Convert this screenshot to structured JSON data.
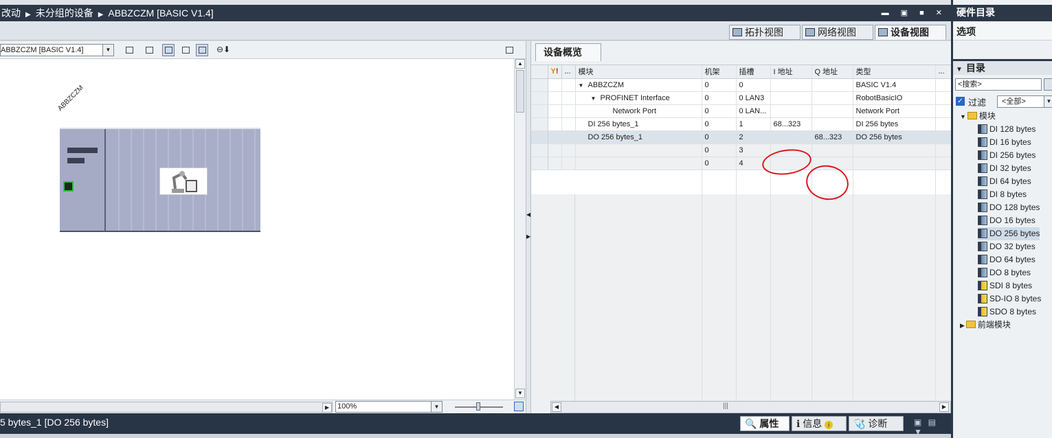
{
  "title_bar": {
    "breadcrumb": [
      "改动",
      "未分组的设备",
      "ABBZCZM [BASIC V1.4]"
    ],
    "window_buttons": "▬ ▣ ■ ✕"
  },
  "view_tabs": [
    "拓扑视图",
    "网络视图",
    "设备视图"
  ],
  "left_toolbar": {
    "device_select": "ABBZCZM [BASIC V1.4]"
  },
  "canvas": {
    "device_label": "ABBZCZM"
  },
  "left_bottom": {
    "zoom": "100%"
  },
  "overview": {
    "tab_label": "设备概览",
    "columns": [
      "...",
      "模块",
      "机架",
      "插槽",
      "I 地址",
      "Q 地址",
      "类型",
      "..."
    ],
    "rows": [
      {
        "indent": 0,
        "expander": "▼",
        "module": "ABBZCZM",
        "rack": "0",
        "slot": "0",
        "i_addr": "",
        "q_addr": "",
        "type": "BASIC V1.4",
        "selected": false
      },
      {
        "indent": 1,
        "expander": "▼",
        "module": "PROFINET Interface",
        "rack": "0",
        "slot": "0 LAN3",
        "i_addr": "",
        "q_addr": "",
        "type": "RobotBasicIO",
        "selected": false
      },
      {
        "indent": 2,
        "expander": "",
        "module": "Network Port",
        "rack": "0",
        "slot": "0 LAN...",
        "i_addr": "",
        "q_addr": "",
        "type": "Network Port",
        "selected": false
      },
      {
        "indent": 0,
        "expander": "",
        "module": "DI 256 bytes_1",
        "rack": "0",
        "slot": "1",
        "i_addr": "68...323",
        "q_addr": "",
        "type": "DI 256 bytes",
        "selected": false
      },
      {
        "indent": 0,
        "expander": "",
        "module": "DO 256 bytes_1",
        "rack": "0",
        "slot": "2",
        "i_addr": "",
        "q_addr": "68...323",
        "type": "DO 256 bytes",
        "selected": true
      },
      {
        "indent": 0,
        "expander": "",
        "module": "",
        "rack": "0",
        "slot": "3",
        "i_addr": "",
        "q_addr": "",
        "type": "",
        "selected": false
      },
      {
        "indent": 0,
        "expander": "",
        "module": "",
        "rack": "0",
        "slot": "4",
        "i_addr": "",
        "q_addr": "",
        "type": "",
        "selected": false
      }
    ]
  },
  "status_bar": {
    "text": "5 bytes_1 [DO 256 bytes]",
    "tabs": [
      "属性",
      "信息",
      "诊断"
    ]
  },
  "catalog": {
    "title": "硬件目录",
    "options": "选项",
    "section": "目录",
    "search_placeholder": "<搜索>",
    "filter_label": "过滤",
    "filter_value": "<全部>",
    "module_folder": "模块",
    "items": [
      {
        "label": "DI 128 bytes",
        "kind": "blue"
      },
      {
        "label": "DI 16 bytes",
        "kind": "blue"
      },
      {
        "label": "DI 256 bytes",
        "kind": "blue"
      },
      {
        "label": "DI 32 bytes",
        "kind": "blue"
      },
      {
        "label": "DI 64 bytes",
        "kind": "blue"
      },
      {
        "label": "DI 8 bytes",
        "kind": "blue"
      },
      {
        "label": "DO 128 bytes",
        "kind": "blue"
      },
      {
        "label": "DO 16 bytes",
        "kind": "blue"
      },
      {
        "label": "DO 256 bytes",
        "kind": "blue"
      },
      {
        "label": "DO 32 bytes",
        "kind": "blue"
      },
      {
        "label": "DO 64 bytes",
        "kind": "blue"
      },
      {
        "label": "DO 8 bytes",
        "kind": "blue"
      },
      {
        "label": "SDI 8 bytes",
        "kind": "yellow"
      },
      {
        "label": "SD-IO 8 bytes",
        "kind": "yellow"
      },
      {
        "label": "SDO 8 bytes",
        "kind": "yellow"
      }
    ],
    "selected_item": "DO 256 bytes",
    "head_module_folder": "前端模块"
  }
}
